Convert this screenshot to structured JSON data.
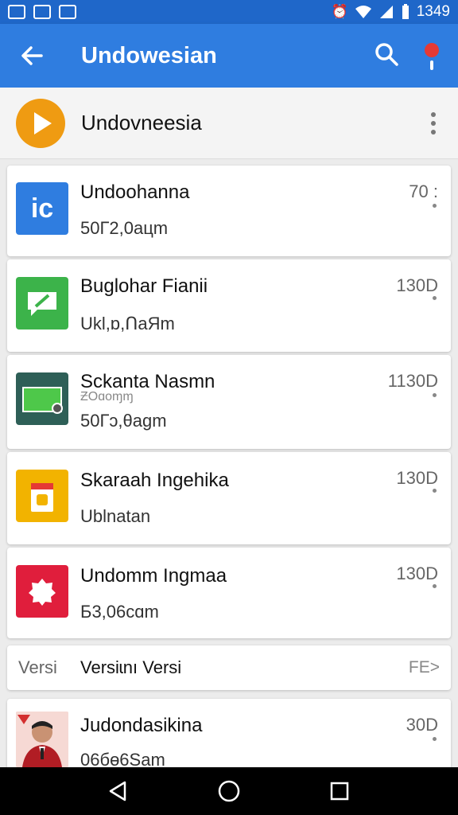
{
  "status_bar": {
    "time": "1349",
    "icons": [
      "image-icon",
      "mail-icon",
      "grid-icon",
      "alarm-icon",
      "wifi-icon",
      "signal-icon",
      "battery-icon"
    ]
  },
  "app_bar": {
    "title": "Undowesian",
    "back_icon": "arrow-left-icon",
    "search_icon": "search-icon",
    "notification_icon": "alert-icon"
  },
  "sub_header": {
    "title": "Undovneesia"
  },
  "items": [
    {
      "title": "Undoohanna",
      "subtitle": "50Г2,0aцm",
      "meta": "70 :",
      "icon": "ic-icon",
      "color": "#2f7de0"
    },
    {
      "title": "Buglohar Fianii",
      "subtitle": "Ukl,ɒ,ՈaЯm",
      "meta": "130D",
      "icon": "chat-icon",
      "color": "#3cb34a"
    },
    {
      "title": "Sckanta Nasmn",
      "extra": "ƵOɑoɱɱ",
      "subtitle": "50Гɔ,θaɡm",
      "meta": "1130D",
      "icon": "window-icon",
      "color": "#2e5f57"
    },
    {
      "title": "Skaraah Ingehika",
      "subtitle": "Ublnatan",
      "meta": "130D",
      "icon": "card-icon",
      "color": "#f2b300"
    },
    {
      "title": "Undomm Ingmaa",
      "subtitle": "Б3,06cɑm",
      "meta": "130D",
      "icon": "badge-icon",
      "color": "#e01e3c"
    }
  ],
  "version": {
    "label": "Versi",
    "text": "Versiɩnı Versi",
    "right": "FE>"
  },
  "last_item": {
    "title": "Judondasikina",
    "subtitle": "06бɵ6Sam",
    "meta": "30D",
    "icon": "avatar"
  },
  "nav": {
    "back": "back-triangle-icon",
    "home": "home-circle-icon",
    "recent": "recent-square-icon"
  }
}
